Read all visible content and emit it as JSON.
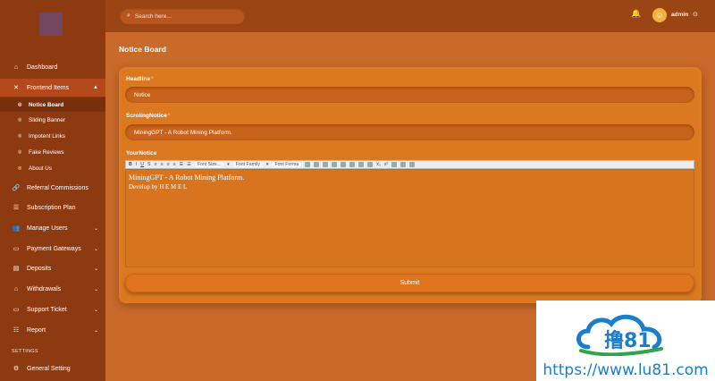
{
  "sidebar": {
    "items": [
      {
        "label": "Dashboard",
        "icon": "home-icon",
        "glyph": "⌂"
      },
      {
        "label": "Frontend Items",
        "icon": "tools-icon",
        "glyph": "✕",
        "arrow": "▲"
      },
      {
        "label": "Referral Commissions",
        "icon": "link-icon",
        "glyph": "🔗"
      },
      {
        "label": "Subscription Plan",
        "icon": "list-icon",
        "glyph": "☰"
      },
      {
        "label": "Manage Users",
        "icon": "users-icon",
        "glyph": "👥",
        "arrow": "⌄"
      },
      {
        "label": "Payment Gateways",
        "icon": "card-icon",
        "glyph": "▭",
        "arrow": "⌄"
      },
      {
        "label": "Deposits",
        "icon": "deposit-icon",
        "glyph": "▤",
        "arrow": "⌄"
      },
      {
        "label": "Withdrawals",
        "icon": "bank-icon",
        "glyph": "⌂",
        "arrow": "⌄"
      },
      {
        "label": "Support Ticket",
        "icon": "ticket-icon",
        "glyph": "▭",
        "arrow": "⌄"
      },
      {
        "label": "Report",
        "icon": "report-icon",
        "glyph": "☷",
        "arrow": "⌄"
      },
      {
        "label": "General Setting",
        "icon": "gear-icon",
        "glyph": "⚙"
      }
    ],
    "sub_items": [
      {
        "label": "Notice Board"
      },
      {
        "label": "Sliding Banner"
      },
      {
        "label": "Impotent Links"
      },
      {
        "label": "Fake Reviews"
      },
      {
        "label": "About Us"
      }
    ],
    "settings_label": "SETTINGS"
  },
  "header": {
    "search_placeholder": "Search here...",
    "user_name": "admin"
  },
  "main": {
    "page_title": "Notice Board",
    "headline_label": "Headline",
    "headline_value": "Notice",
    "scrolling_label": "ScrolingNotice",
    "scrolling_value": "MiningGPT - A Robot Mining Platform.",
    "your_notice_label": "YourNotice",
    "toolbar": {
      "font_size": "Font Size...",
      "font_family": "Font Family",
      "font_format": "Font Forma"
    },
    "editor_line1": "MiningGPT - A Robot Mining Platform.",
    "editor_line2": "Develop by H E M E L",
    "submit_label": "Submit"
  },
  "watermark": {
    "logo_text": "撸81",
    "url": "https://www.lu81.com"
  }
}
